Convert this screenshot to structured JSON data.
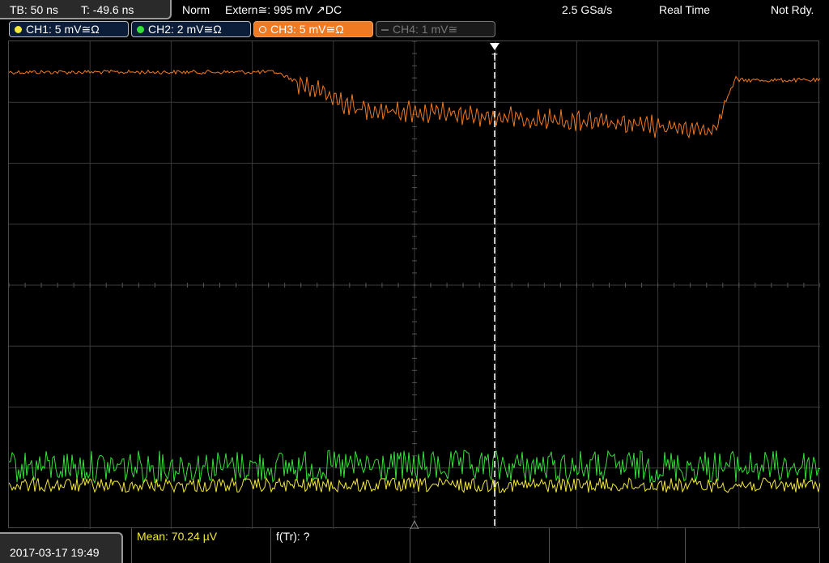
{
  "status": {
    "timebase": "TB: 50 ns",
    "trigger_time": "T: -49.6 ns",
    "trigger_mode": "Norm",
    "trigger_source": "Extern≅: 995 mV ↗DC",
    "sample_rate": "2.5 GSa/s",
    "acq_mode": "Real Time",
    "state": "Not Rdy."
  },
  "channels": [
    {
      "label": "CH1: 5 mV≅Ω",
      "color": "#f4e83a",
      "state": "on"
    },
    {
      "label": "CH2: 2 mV≅Ω",
      "color": "#35e03a",
      "state": "on"
    },
    {
      "label": "CH3: 5 mV≅Ω",
      "color": "#f07a22",
      "state": "active"
    },
    {
      "label": "CH4: 1 mV≅",
      "color": "#666666",
      "state": "off"
    }
  ],
  "trigger_marker": "T",
  "measurements": {
    "mean": "Mean: 70.24 µV",
    "freq": "f(Tr): ?"
  },
  "datetime": "2017-03-17  19:49",
  "colors": {
    "ch1": "#f4e83a",
    "ch2": "#35e03a",
    "ch3": "#f07a22",
    "grid": "#3a3a3a",
    "trigger_line": "#ffffff"
  }
}
